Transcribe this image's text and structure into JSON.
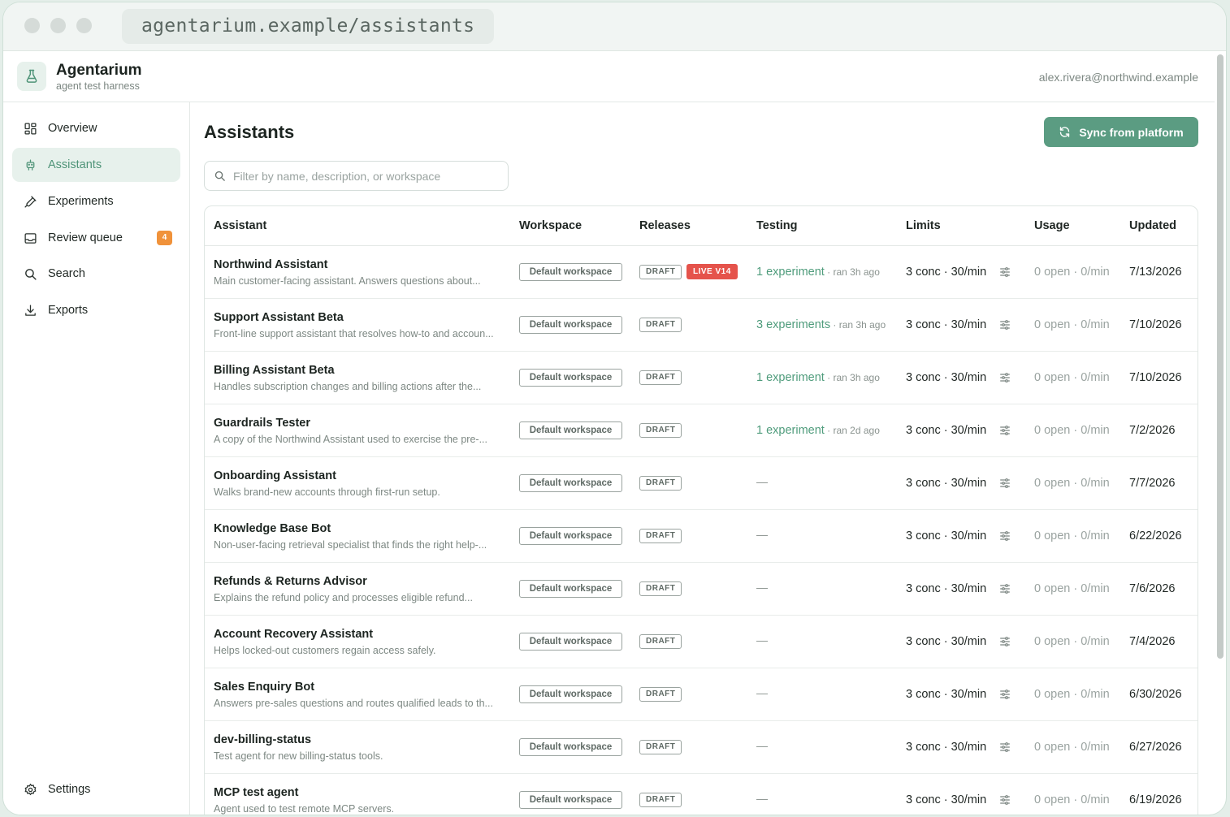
{
  "browser": {
    "url": "agentarium.example/assistants"
  },
  "app": {
    "name": "Agentarium",
    "tagline": "agent test harness",
    "user_email": "alex.rivera@northwind.example"
  },
  "sidebar": {
    "items": [
      {
        "label": "Overview",
        "icon": "grid-icon"
      },
      {
        "label": "Assistants",
        "icon": "bot-icon",
        "active": true
      },
      {
        "label": "Experiments",
        "icon": "flask-icon"
      },
      {
        "label": "Review queue",
        "icon": "inbox-icon",
        "badge": "4"
      },
      {
        "label": "Search",
        "icon": "search-icon"
      },
      {
        "label": "Exports",
        "icon": "download-icon"
      }
    ],
    "footer": {
      "label": "Settings",
      "icon": "gear-icon"
    }
  },
  "page": {
    "title": "Assistants",
    "sync_label": "Sync from platform",
    "filter_placeholder": "Filter by name, description, or workspace"
  },
  "table": {
    "columns": [
      "Assistant",
      "Workspace",
      "Releases",
      "Testing",
      "Limits",
      "Usage",
      "Updated"
    ],
    "rows": [
      {
        "name": "Northwind Assistant",
        "desc": "Main customer-facing assistant. Answers questions about...",
        "workspace": "Default workspace",
        "release": "DRAFT",
        "live": "LIVE V14",
        "testing": "1 experiment",
        "ago": " · ran 3h ago",
        "limits": "3 conc · 30/min",
        "usage": "0 open · 0/min",
        "updated": "7/13/2026"
      },
      {
        "name": "Support Assistant Beta",
        "desc": "Front-line support assistant that resolves how-to and accoun...",
        "workspace": "Default workspace",
        "release": "DRAFT",
        "testing": "3 experiments",
        "ago": " · ran 3h ago",
        "limits": "3 conc · 30/min",
        "usage": "0 open · 0/min",
        "updated": "7/10/2026"
      },
      {
        "name": "Billing Assistant Beta",
        "desc": "Handles subscription changes and billing actions after the...",
        "workspace": "Default workspace",
        "release": "DRAFT",
        "testing": "1 experiment",
        "ago": " · ran 3h ago",
        "limits": "3 conc · 30/min",
        "usage": "0 open · 0/min",
        "updated": "7/10/2026"
      },
      {
        "name": "Guardrails Tester",
        "desc": "A copy of the Northwind Assistant used to exercise the pre-...",
        "workspace": "Default workspace",
        "release": "DRAFT",
        "testing": "1 experiment",
        "ago": " · ran 2d ago",
        "limits": "3 conc · 30/min",
        "usage": "0 open · 0/min",
        "updated": "7/2/2026"
      },
      {
        "name": "Onboarding Assistant",
        "desc": "Walks brand-new accounts through first-run setup.",
        "workspace": "Default workspace",
        "release": "DRAFT",
        "testing": "—",
        "limits": "3 conc · 30/min",
        "usage": "0 open · 0/min",
        "updated": "7/7/2026"
      },
      {
        "name": "Knowledge Base Bot",
        "desc": "Non-user-facing retrieval specialist that finds the right help-...",
        "workspace": "Default workspace",
        "release": "DRAFT",
        "testing": "—",
        "limits": "3 conc · 30/min",
        "usage": "0 open · 0/min",
        "updated": "6/22/2026"
      },
      {
        "name": "Refunds & Returns Advisor",
        "desc": "Explains the refund policy and processes eligible refund...",
        "workspace": "Default workspace",
        "release": "DRAFT",
        "testing": "—",
        "limits": "3 conc · 30/min",
        "usage": "0 open · 0/min",
        "updated": "7/6/2026"
      },
      {
        "name": "Account Recovery Assistant",
        "desc": "Helps locked-out customers regain access safely.",
        "workspace": "Default workspace",
        "release": "DRAFT",
        "testing": "—",
        "limits": "3 conc · 30/min",
        "usage": "0 open · 0/min",
        "updated": "7/4/2026"
      },
      {
        "name": "Sales Enquiry Bot",
        "desc": "Answers pre-sales questions and routes qualified leads to th...",
        "workspace": "Default workspace",
        "release": "DRAFT",
        "testing": "—",
        "limits": "3 conc · 30/min",
        "usage": "0 open · 0/min",
        "updated": "6/30/2026"
      },
      {
        "name": "dev-billing-status",
        "desc": "Test agent for new billing-status tools.",
        "workspace": "Default workspace",
        "release": "DRAFT",
        "testing": "—",
        "limits": "3 conc · 30/min",
        "usage": "0 open · 0/min",
        "updated": "6/27/2026"
      },
      {
        "name": "MCP test agent",
        "desc": "Agent used to test remote MCP servers.",
        "workspace": "Default workspace",
        "release": "DRAFT",
        "testing": "—",
        "limits": "3 conc · 30/min",
        "usage": "0 open · 0/min",
        "updated": "6/19/2026"
      }
    ]
  },
  "colors": {
    "accent": "#5b9c82",
    "live": "#e5534b",
    "badge": "#f0923a"
  }
}
